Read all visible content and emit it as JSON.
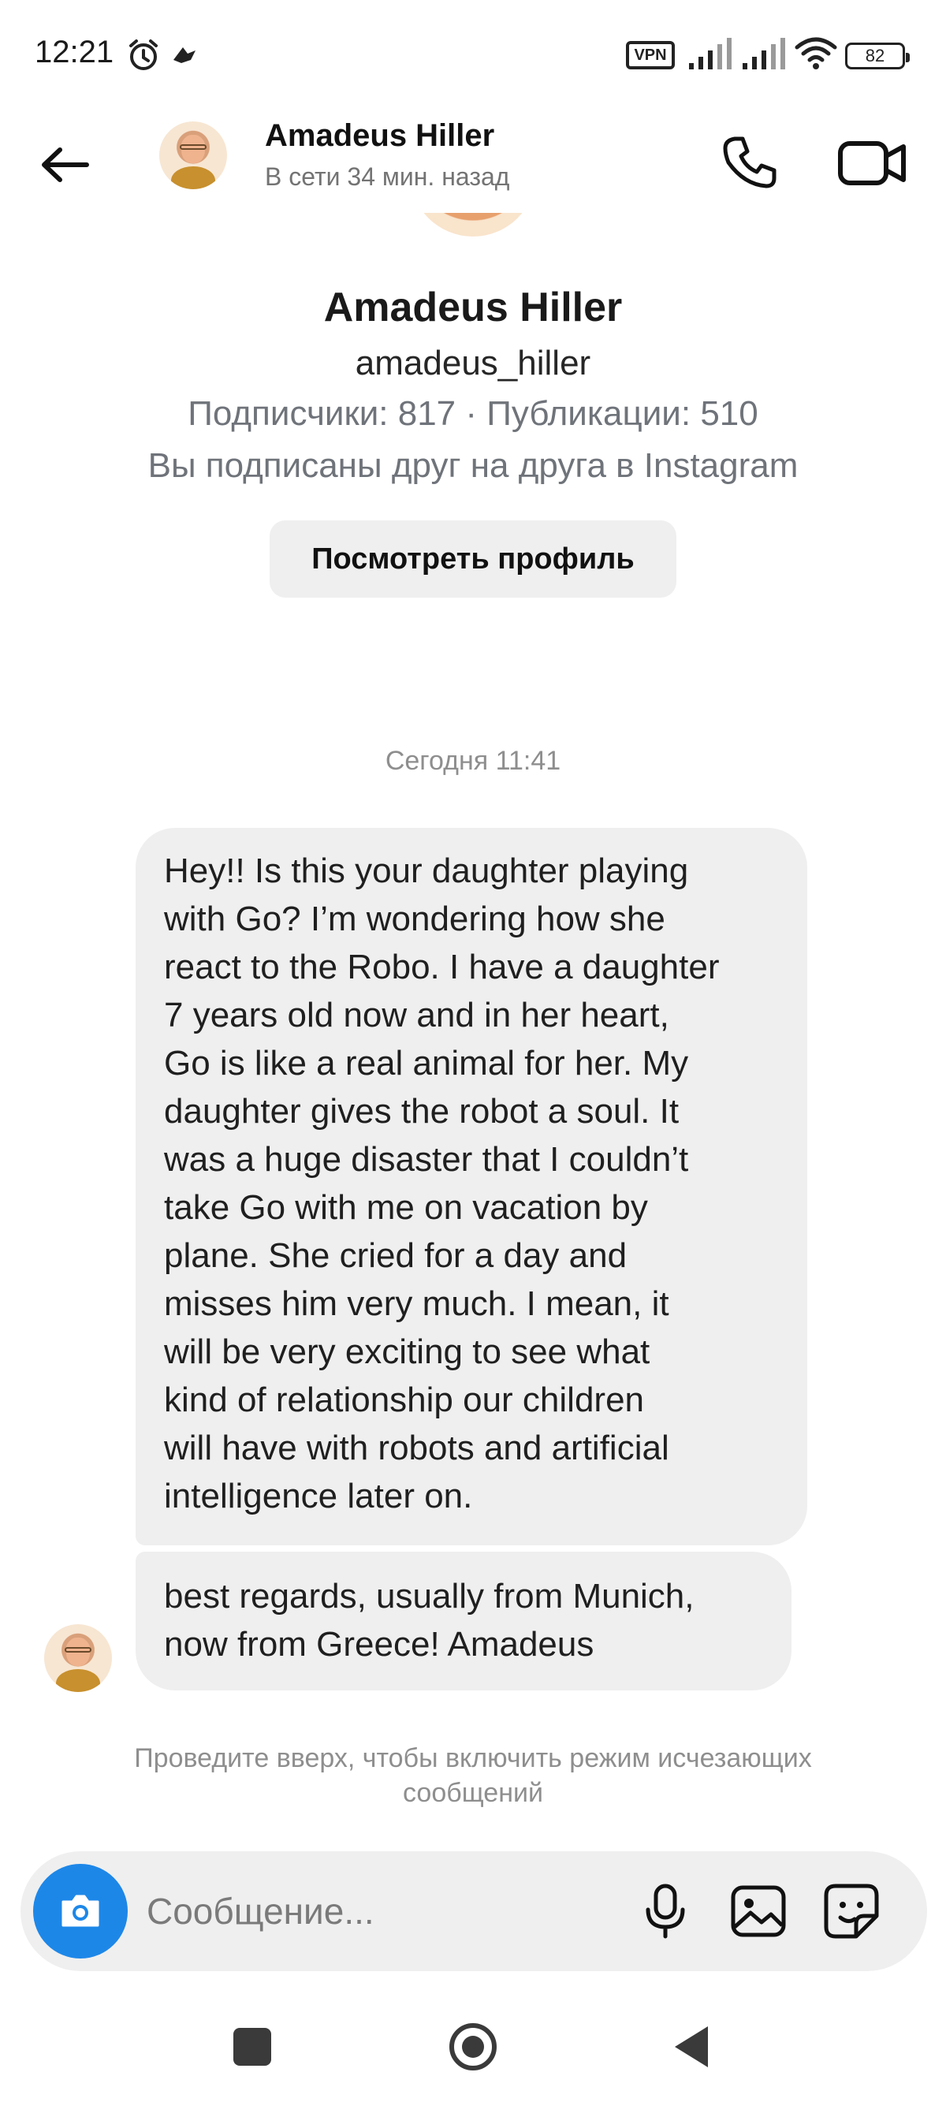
{
  "status_bar": {
    "time": "12:21",
    "vpn": "VPN",
    "battery": "82",
    "icons": [
      "alarm-icon",
      "notification-bird-icon",
      "signal-icon",
      "wifi-icon",
      "battery-icon"
    ]
  },
  "header": {
    "name": "Amadeus Hiller",
    "status": "В сети 34 мин. назад",
    "icons": [
      "back-arrow-icon",
      "phone-icon",
      "video-camera-icon"
    ]
  },
  "profile": {
    "name": "Amadeus Hiller",
    "username": "amadeus_hiller",
    "stats": "Подписчики: 817 · Публикации: 510",
    "mutual": "Вы подписаны друг на друга в Instagram",
    "view_profile_label": "Посмотреть профиль"
  },
  "chat": {
    "date_divider": "Сегодня 11:41",
    "messages": [
      {
        "sender": "Amadeus Hiller",
        "lines": [
          "Hey!! Is this your daughter playing",
          "with Go? I’m wondering how she",
          "react to the Robo. I have a daughter",
          "7 years old now and in her heart,",
          "Go is like a real animal for her. My",
          "daughter gives the robot a soul. It",
          "was a huge disaster that I couldn’t",
          "take Go with me on vacation by",
          "plane. She cried for a day and",
          "misses him very much. I mean, it",
          "will be very exciting to see what",
          "kind of relationship our children",
          "will have with robots and artificial",
          "intelligence later on."
        ]
      },
      {
        "sender": "Amadeus Hiller",
        "lines": [
          "best regards, usually from Munich,",
          "now from Greece! Amadeus"
        ]
      }
    ],
    "vanish_hint_lines": [
      "Проведите вверх, чтобы включить режим исчезающих",
      "сообщений"
    ]
  },
  "composer": {
    "placeholder": "Сообщение...",
    "icons": [
      "camera-icon",
      "microphone-icon",
      "gallery-icon",
      "sticker-icon"
    ],
    "accent_color": "#1d87e8"
  },
  "nav_bar": {
    "icons": [
      "recents-square-icon",
      "home-circle-icon",
      "back-triangle-icon"
    ]
  }
}
